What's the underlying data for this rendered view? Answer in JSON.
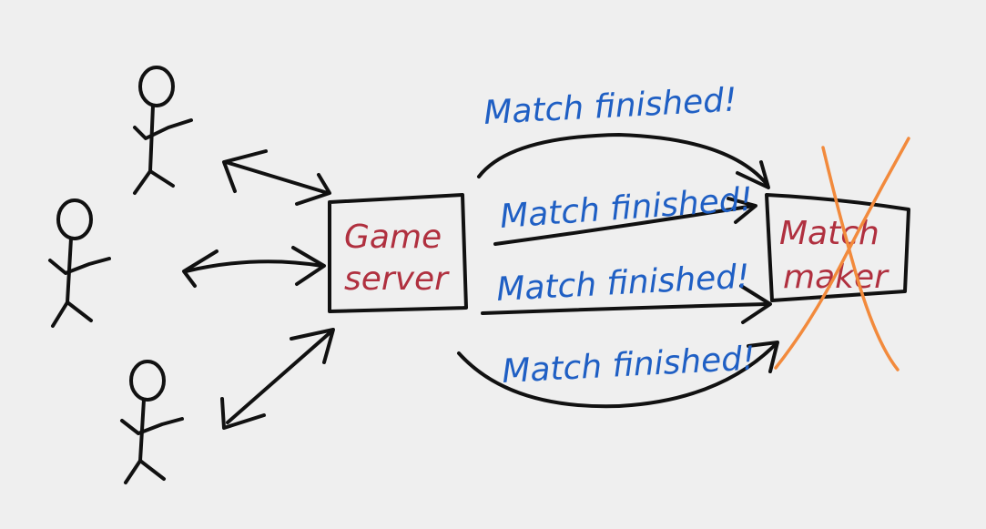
{
  "colors": {
    "background": "#efefef",
    "ink": "#111111",
    "server_text": "#b0303f",
    "message_text": "#1f5fc4",
    "cross": "#f28a3c"
  },
  "game_server": {
    "line1": "Game",
    "line2": "server"
  },
  "matchmaker": {
    "line1": "Match",
    "line2": "maker",
    "crossed_out": true
  },
  "messages": [
    "Match finished!",
    "Match finished!",
    "Match finished!",
    "Match finished!"
  ],
  "players_count": 3
}
